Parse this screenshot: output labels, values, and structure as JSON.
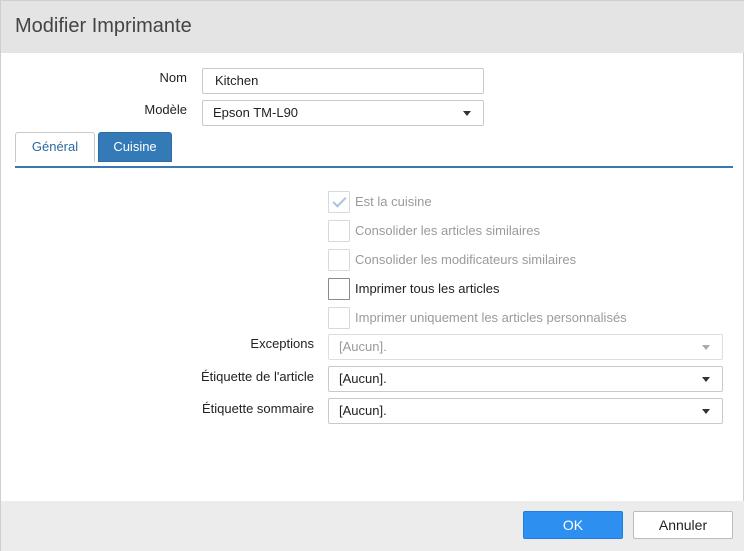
{
  "dialog": {
    "title": "Modifier Imprimante"
  },
  "form": {
    "name_label": "Nom",
    "name_value": "Kitchen",
    "model_label": "Modèle",
    "model_value": "Epson TM-L90"
  },
  "tabs": [
    {
      "label": "Général",
      "active": false
    },
    {
      "label": "Cuisine",
      "active": true
    }
  ],
  "kitchen": {
    "checkboxes": [
      {
        "label": "Est la cuisine",
        "checked": true,
        "enabled": false
      },
      {
        "label": "Consolider les articles similaires",
        "checked": false,
        "enabled": false
      },
      {
        "label": "Consolider les modificateurs similaires",
        "checked": false,
        "enabled": false
      },
      {
        "label": "Imprimer tous les articles",
        "checked": false,
        "enabled": true
      },
      {
        "label": "Imprimer uniquement les articles personnalisés",
        "checked": false,
        "enabled": false
      }
    ],
    "exceptions_label": "Exceptions",
    "exceptions_value": "[Aucun].",
    "item_label_label": "Étiquette de l'article",
    "item_label_value": "[Aucun].",
    "summary_label_label": "Étiquette sommaire",
    "summary_label_value": "[Aucun]."
  },
  "footer": {
    "ok_label": "OK",
    "cancel_label": "Annuler"
  }
}
